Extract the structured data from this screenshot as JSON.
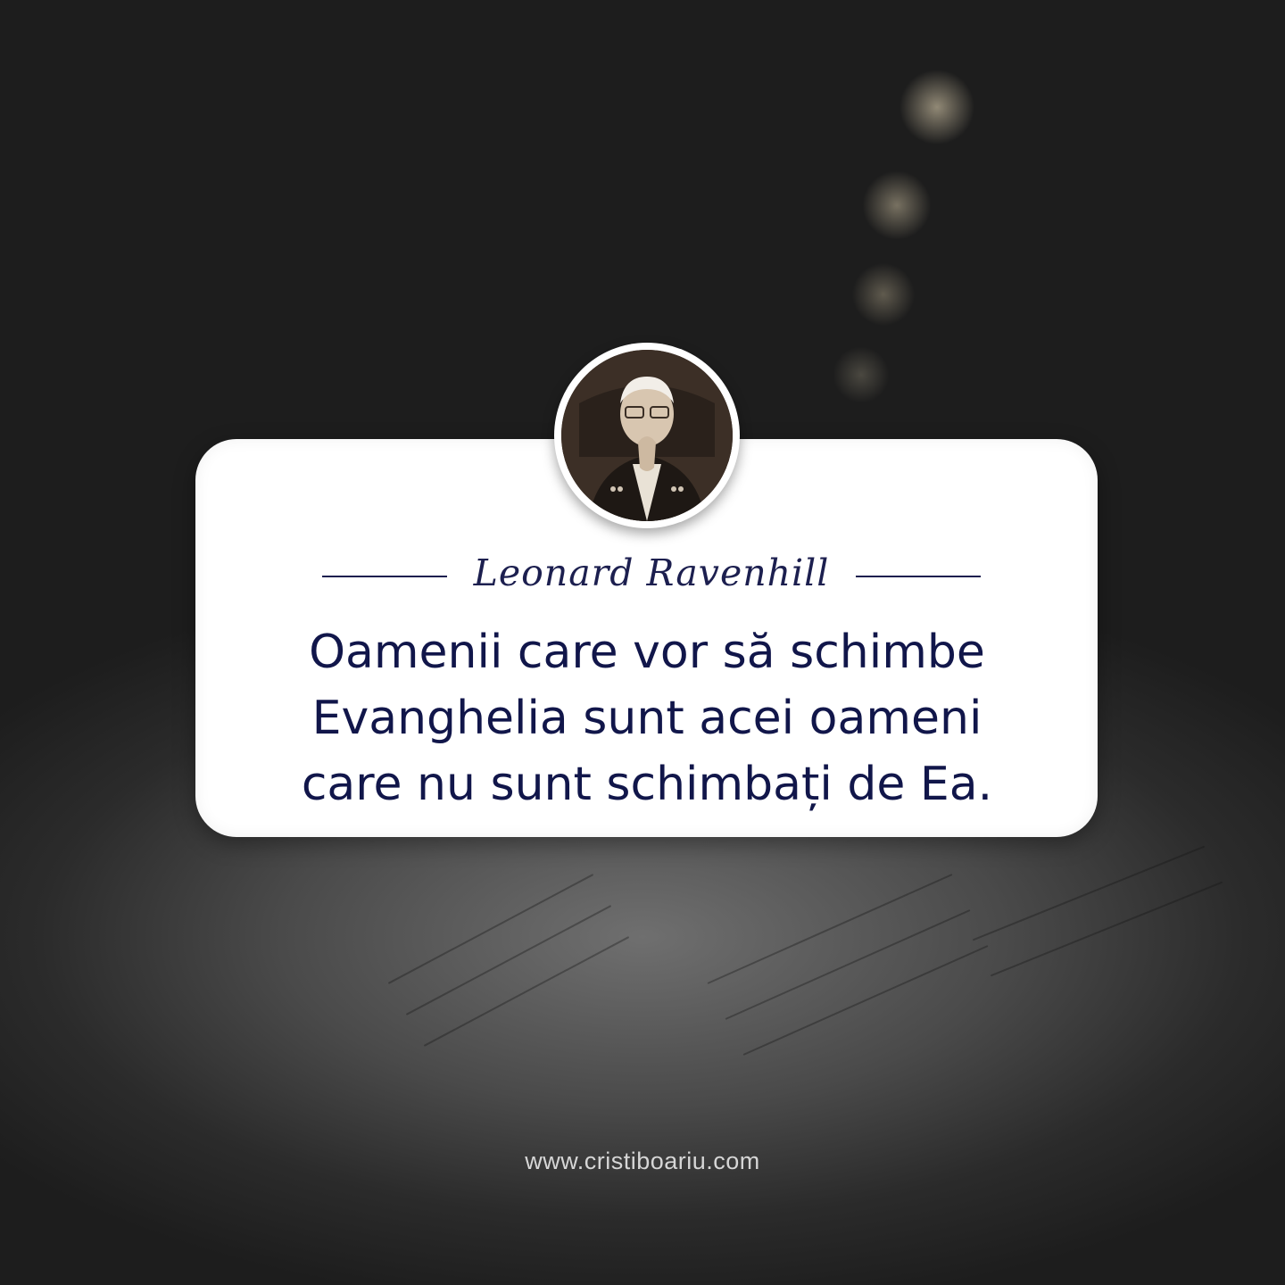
{
  "card": {
    "author": "Leonard Ravenhill",
    "quote_lines": [
      "Oamenii care vor să schimbe",
      "Evanghelia sunt acei oameni",
      "care nu sunt schimbați de Ea."
    ]
  },
  "footer": {
    "website": "www.cristiboariu.com"
  },
  "colors": {
    "text_navy": "#11164a",
    "card_bg": "#ffffff",
    "footer_text": "#d6d6d6"
  },
  "icons": {
    "portrait": "author-portrait-photo"
  }
}
